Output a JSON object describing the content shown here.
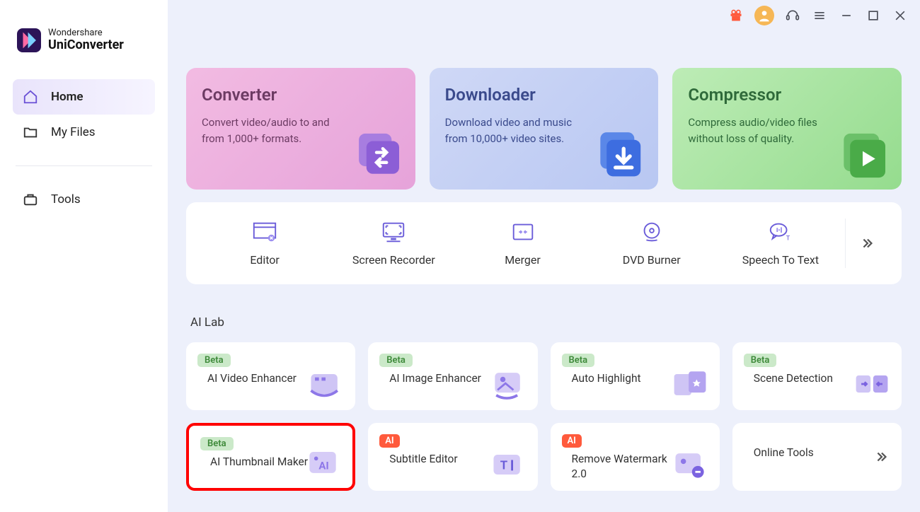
{
  "app": {
    "brand": "Wondershare",
    "product": "UniConverter"
  },
  "sidebar": {
    "items": [
      {
        "label": "Home",
        "icon": "home-icon",
        "active": true
      },
      {
        "label": "My Files",
        "icon": "folder-icon",
        "active": false
      }
    ],
    "tools_label": "Tools"
  },
  "hero": [
    {
      "title": "Converter",
      "desc": "Convert video/audio to and from 1,000+ formats."
    },
    {
      "title": "Downloader",
      "desc": "Download video and music from 10,000+ video sites."
    },
    {
      "title": "Compressor",
      "desc": "Compress audio/video files without loss of quality."
    }
  ],
  "tools": [
    {
      "label": "Editor"
    },
    {
      "label": "Screen Recorder"
    },
    {
      "label": "Merger"
    },
    {
      "label": "DVD Burner"
    },
    {
      "label": "Speech To Text"
    }
  ],
  "ai_lab": {
    "title": "AI Lab",
    "cards": [
      {
        "badge": "Beta",
        "badge_type": "beta",
        "title": "AI Video Enhancer"
      },
      {
        "badge": "Beta",
        "badge_type": "beta",
        "title": "AI Image Enhancer"
      },
      {
        "badge": "Beta",
        "badge_type": "beta",
        "title": "Auto Highlight"
      },
      {
        "badge": "Beta",
        "badge_type": "beta",
        "title": "Scene Detection"
      },
      {
        "badge": "Beta",
        "badge_type": "beta",
        "title": "AI Thumbnail Maker",
        "highlight": true
      },
      {
        "badge": "AI",
        "badge_type": "ai",
        "title": "Subtitle Editor"
      },
      {
        "badge": "AI",
        "badge_type": "ai",
        "title": "Remove Watermark 2.0"
      },
      {
        "title": "Online Tools",
        "arrow": true
      }
    ]
  }
}
